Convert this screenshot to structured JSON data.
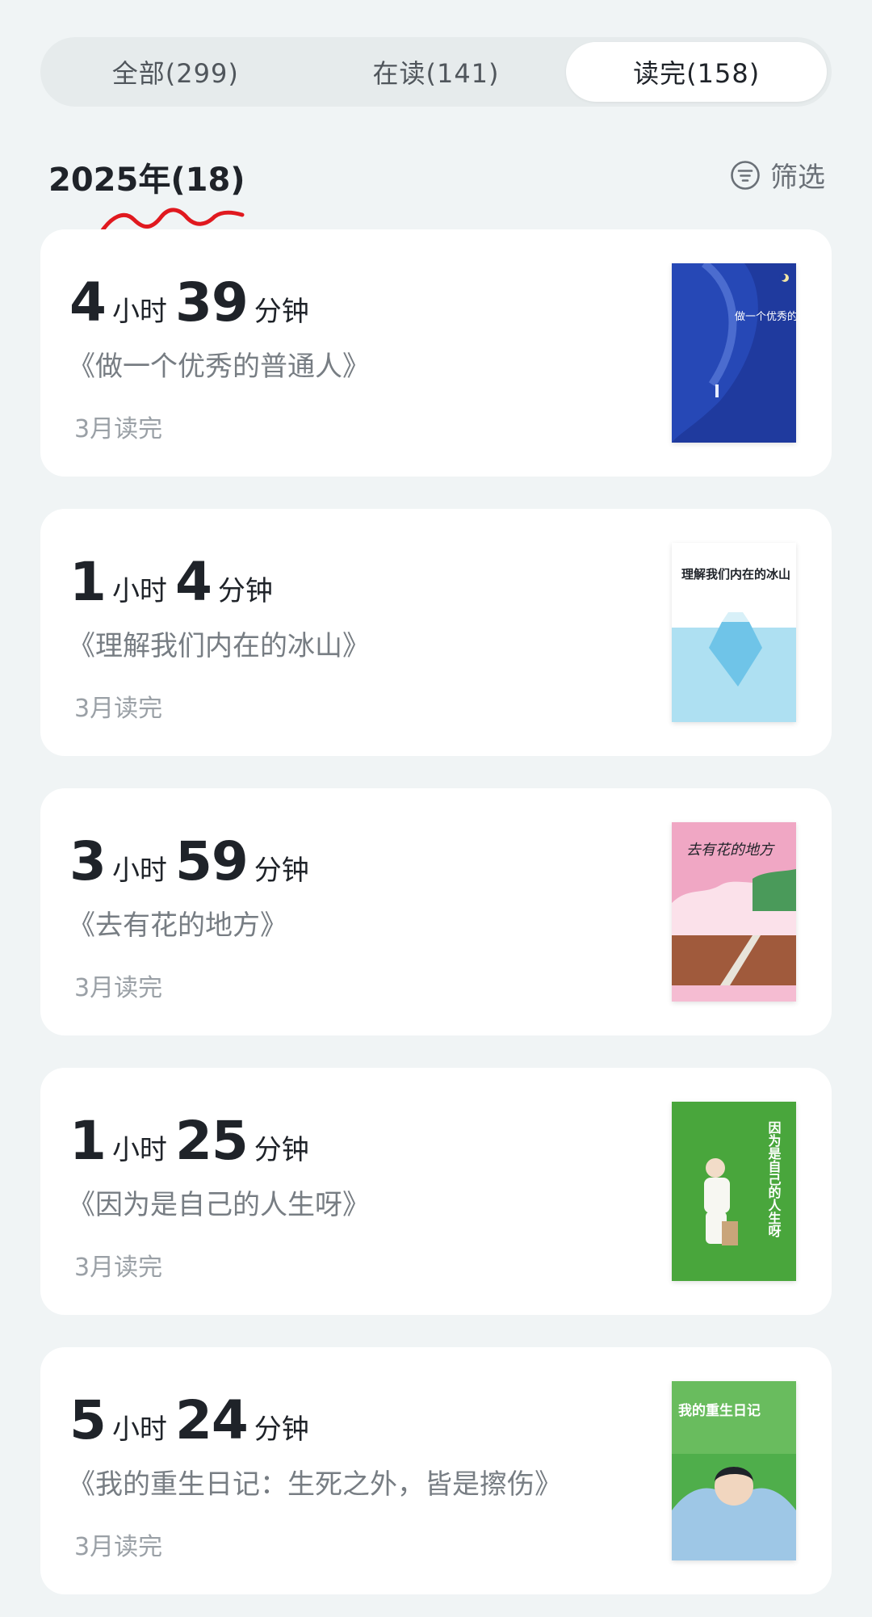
{
  "tabs": [
    {
      "label": "全部(299)",
      "active": false
    },
    {
      "label": "在读(141)",
      "active": false
    },
    {
      "label": "读完(158)",
      "active": true
    }
  ],
  "year_header": "2025年(18)",
  "filter_label": "筛选",
  "cover_icon_names": [
    "book-cover-1",
    "book-cover-2",
    "book-cover-3",
    "book-cover-4",
    "book-cover-5"
  ],
  "books": [
    {
      "hours": "4",
      "hours_unit": "小时",
      "minutes": "39",
      "minutes_unit": "分钟",
      "title": "《做一个优秀的普通人》",
      "status": "3月读完",
      "cover_text": "做一个优秀的普通人"
    },
    {
      "hours": "1",
      "hours_unit": "小时",
      "minutes": "4",
      "minutes_unit": "分钟",
      "title": "《理解我们内在的冰山》",
      "status": "3月读完",
      "cover_text": "理解我们内在的冰山"
    },
    {
      "hours": "3",
      "hours_unit": "小时",
      "minutes": "59",
      "minutes_unit": "分钟",
      "title": "《去有花的地方》",
      "status": "3月读完",
      "cover_text": "去有花的地方"
    },
    {
      "hours": "1",
      "hours_unit": "小时",
      "minutes": "25",
      "minutes_unit": "分钟",
      "title": "《因为是自己的人生呀》",
      "status": "3月读完",
      "cover_text": "因为是自己的人生呀"
    },
    {
      "hours": "5",
      "hours_unit": "小时",
      "minutes": "24",
      "minutes_unit": "分钟",
      "title": "《我的重生日记：生死之外，皆是擦伤》",
      "status": "3月读完",
      "cover_text": "我的重生日记"
    }
  ],
  "colors": {
    "background": "#f0f4f5",
    "card": "#ffffff",
    "annotation_red": "#e0191f",
    "text_primary": "#1f2329",
    "text_secondary": "#777d83",
    "text_tertiary": "#9aa0a6"
  }
}
